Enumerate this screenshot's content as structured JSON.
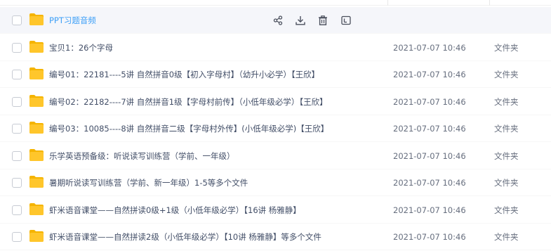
{
  "files": [
    {
      "name": "PPT习题音频",
      "date": "",
      "type": "",
      "hovered": true
    },
    {
      "name": "宝贝1：26个字母",
      "date": "2021-07-07 10:46",
      "type": "文件夹"
    },
    {
      "name": "编号01：22181----5讲 自然拼音0级【初入字母村】（幼升小必学）【王欣】",
      "date": "2021-07-07 10:46",
      "type": "文件夹"
    },
    {
      "name": "编号02：22182----7讲 自然拼音1级【字母村前传】（小低年级必学）【王欣】",
      "date": "2021-07-07 10:46",
      "type": "文件夹"
    },
    {
      "name": "编号03：10085----8讲 自然拼音二级【字母村外传】(小低年级必学)【王欣】",
      "date": "2021-07-07 10:46",
      "type": "文件夹"
    },
    {
      "name": "乐学英语预备级：听说读写训练营（学前、一年级）",
      "date": "2021-07-07 10:46",
      "type": "文件夹"
    },
    {
      "name": "暑期听说读写训练营（学前、新一年级）1-5等多个文件",
      "date": "2021-07-07 10:46",
      "type": "文件夹"
    },
    {
      "name": "虾米语音课堂——自然拼读0级+1级（小低年级必学）【16讲 杨雅静】",
      "date": "2021-07-07 10:46",
      "type": "文件夹"
    },
    {
      "name": "虾米语音课堂——自然拼读2级（小低年级必学）【10讲 杨雅静】等多个文件",
      "date": "2021-07-07 10:46",
      "type": "文件夹"
    }
  ],
  "hover_actions": [
    "share-icon",
    "download-icon",
    "delete-icon",
    "more-icon"
  ],
  "colors": {
    "folder": "#ffc62b",
    "folder_tab": "#f5b400",
    "accent": "#3ea0f7",
    "icon": "#4a4f5c"
  }
}
